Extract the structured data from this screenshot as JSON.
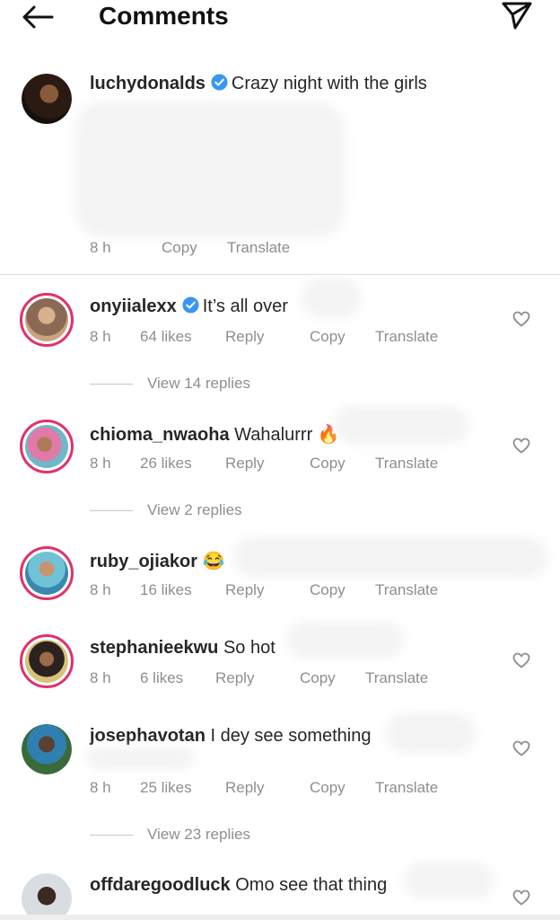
{
  "header": {
    "title": "Comments",
    "back_icon": "arrow-left-icon",
    "share_icon": "paper-plane-icon"
  },
  "caption": {
    "username": "luchydonalds",
    "text": "Crazy night with the girls",
    "time": "8 h",
    "copy": "Copy",
    "translate": "Translate"
  },
  "comments": [
    {
      "username": "onyiialexx",
      "verified": true,
      "text": "It’s all over",
      "time": "8 h",
      "likes": "64 likes",
      "reply": "Reply",
      "copy": "Copy",
      "translate": "Translate",
      "view_replies": "View 14 replies"
    },
    {
      "username": "chioma_nwaoha",
      "verified": false,
      "text": "Wahalurrr 🔥",
      "time": "8 h",
      "likes": "26 likes",
      "reply": "Reply",
      "copy": "Copy",
      "translate": "Translate",
      "view_replies": "View 2 replies"
    },
    {
      "username": "ruby_ojiakor",
      "verified": false,
      "text": "😂",
      "time": "8 h",
      "likes": "16 likes",
      "reply": "Reply",
      "copy": "Copy",
      "translate": "Translate",
      "view_replies": ""
    },
    {
      "username": "stephanieekwu",
      "verified": false,
      "text": "So hot",
      "time": "8 h",
      "likes": "6 likes",
      "reply": "Reply",
      "copy": "Copy",
      "translate": "Translate",
      "view_replies": ""
    },
    {
      "username": "josephavotan",
      "verified": false,
      "text": "I dey see something",
      "time": "8 h",
      "likes": "25 likes",
      "reply": "Reply",
      "copy": "Copy",
      "translate": "Translate",
      "view_replies": "View 23 replies"
    },
    {
      "username": "offdaregoodluck",
      "verified": false,
      "text": "Omo see that thing",
      "time": "",
      "likes": "",
      "reply": "",
      "copy": "",
      "translate": "",
      "view_replies": ""
    }
  ],
  "colors": {
    "verified": "#3897f0",
    "story_ring": "#e1306c",
    "meta_text": "#8e8e8e"
  }
}
